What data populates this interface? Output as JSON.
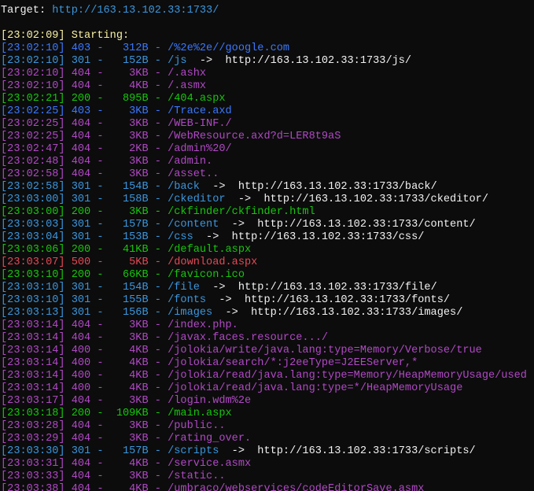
{
  "header": {
    "target_label": "Target: ",
    "target_url": "http://163.13.102.33:1733/",
    "start_time": "[23:02:09]",
    "start_text": " Starting:"
  },
  "colors": {
    "301": "cyan",
    "403": "blue",
    "404": "magenta",
    "400": "magenta",
    "200": "green",
    "500": "red"
  },
  "log": [
    {
      "time": "[23:02:10]",
      "code": "403",
      "size": "312B",
      "path": "/%2e%2e//google.com",
      "redirect": ""
    },
    {
      "time": "[23:02:10]",
      "code": "301",
      "size": "152B",
      "path": "/js",
      "redirect": "http://163.13.102.33:1733/js/"
    },
    {
      "time": "[23:02:10]",
      "code": "404",
      "size": "3KB",
      "path": "/.ashx",
      "redirect": ""
    },
    {
      "time": "[23:02:10]",
      "code": "404",
      "size": "4KB",
      "path": "/.asmx",
      "redirect": ""
    },
    {
      "time": "[23:02:21]",
      "code": "200",
      "size": "895B",
      "path": "/404.aspx",
      "redirect": ""
    },
    {
      "time": "[23:02:25]",
      "code": "403",
      "size": "3KB",
      "path": "/Trace.axd",
      "redirect": ""
    },
    {
      "time": "[23:02:25]",
      "code": "404",
      "size": "3KB",
      "path": "/WEB-INF./",
      "redirect": ""
    },
    {
      "time": "[23:02:25]",
      "code": "404",
      "size": "3KB",
      "path": "/WebResource.axd?d=LER8t9aS",
      "redirect": ""
    },
    {
      "time": "[23:02:47]",
      "code": "404",
      "size": "2KB",
      "path": "/admin%20/",
      "redirect": ""
    },
    {
      "time": "[23:02:48]",
      "code": "404",
      "size": "3KB",
      "path": "/admin.",
      "redirect": ""
    },
    {
      "time": "[23:02:58]",
      "code": "404",
      "size": "3KB",
      "path": "/asset..",
      "redirect": ""
    },
    {
      "time": "[23:02:58]",
      "code": "301",
      "size": "154B",
      "path": "/back",
      "redirect": "http://163.13.102.33:1733/back/"
    },
    {
      "time": "[23:03:00]",
      "code": "301",
      "size": "158B",
      "path": "/ckeditor",
      "redirect": "http://163.13.102.33:1733/ckeditor/"
    },
    {
      "time": "[23:03:00]",
      "code": "200",
      "size": "3KB",
      "path": "/ckfinder/ckfinder.html",
      "redirect": ""
    },
    {
      "time": "[23:03:03]",
      "code": "301",
      "size": "157B",
      "path": "/content",
      "redirect": "http://163.13.102.33:1733/content/"
    },
    {
      "time": "[23:03:04]",
      "code": "301",
      "size": "153B",
      "path": "/css",
      "redirect": "http://163.13.102.33:1733/css/"
    },
    {
      "time": "[23:03:06]",
      "code": "200",
      "size": "41KB",
      "path": "/default.aspx",
      "redirect": ""
    },
    {
      "time": "[23:03:07]",
      "code": "500",
      "size": "5KB",
      "path": "/download.aspx",
      "redirect": ""
    },
    {
      "time": "[23:03:10]",
      "code": "200",
      "size": "66KB",
      "path": "/favicon.ico",
      "redirect": ""
    },
    {
      "time": "[23:03:10]",
      "code": "301",
      "size": "154B",
      "path": "/file",
      "redirect": "http://163.13.102.33:1733/file/"
    },
    {
      "time": "[23:03:10]",
      "code": "301",
      "size": "155B",
      "path": "/fonts",
      "redirect": "http://163.13.102.33:1733/fonts/"
    },
    {
      "time": "[23:03:13]",
      "code": "301",
      "size": "156B",
      "path": "/images",
      "redirect": "http://163.13.102.33:1733/images/"
    },
    {
      "time": "[23:03:14]",
      "code": "404",
      "size": "3KB",
      "path": "/index.php.",
      "redirect": ""
    },
    {
      "time": "[23:03:14]",
      "code": "404",
      "size": "3KB",
      "path": "/javax.faces.resource.../",
      "redirect": ""
    },
    {
      "time": "[23:03:14]",
      "code": "400",
      "size": "4KB",
      "path": "/jolokia/write/java.lang:type=Memory/Verbose/true",
      "redirect": ""
    },
    {
      "time": "[23:03:14]",
      "code": "400",
      "size": "4KB",
      "path": "/jolokia/search/*:j2eeType=J2EEServer,*",
      "redirect": ""
    },
    {
      "time": "[23:03:14]",
      "code": "400",
      "size": "4KB",
      "path": "/jolokia/read/java.lang:type=Memory/HeapMemoryUsage/used",
      "redirect": ""
    },
    {
      "time": "[23:03:14]",
      "code": "400",
      "size": "4KB",
      "path": "/jolokia/read/java.lang:type=*/HeapMemoryUsage",
      "redirect": ""
    },
    {
      "time": "[23:03:17]",
      "code": "404",
      "size": "3KB",
      "path": "/login.wdm%2e",
      "redirect": ""
    },
    {
      "time": "[23:03:18]",
      "code": "200",
      "size": "109KB",
      "path": "/main.aspx",
      "redirect": ""
    },
    {
      "time": "[23:03:28]",
      "code": "404",
      "size": "3KB",
      "path": "/public..",
      "redirect": ""
    },
    {
      "time": "[23:03:29]",
      "code": "404",
      "size": "3KB",
      "path": "/rating_over.",
      "redirect": ""
    },
    {
      "time": "[23:03:30]",
      "code": "301",
      "size": "157B",
      "path": "/scripts",
      "redirect": "http://163.13.102.33:1733/scripts/"
    },
    {
      "time": "[23:03:31]",
      "code": "404",
      "size": "4KB",
      "path": "/service.asmx",
      "redirect": ""
    },
    {
      "time": "[23:03:33]",
      "code": "404",
      "size": "3KB",
      "path": "/static..",
      "redirect": ""
    },
    {
      "time": "[23:03:38]",
      "code": "404",
      "size": "4KB",
      "path": "/umbraco/webservices/codeEditorSave.asmx",
      "redirect": ""
    }
  ]
}
